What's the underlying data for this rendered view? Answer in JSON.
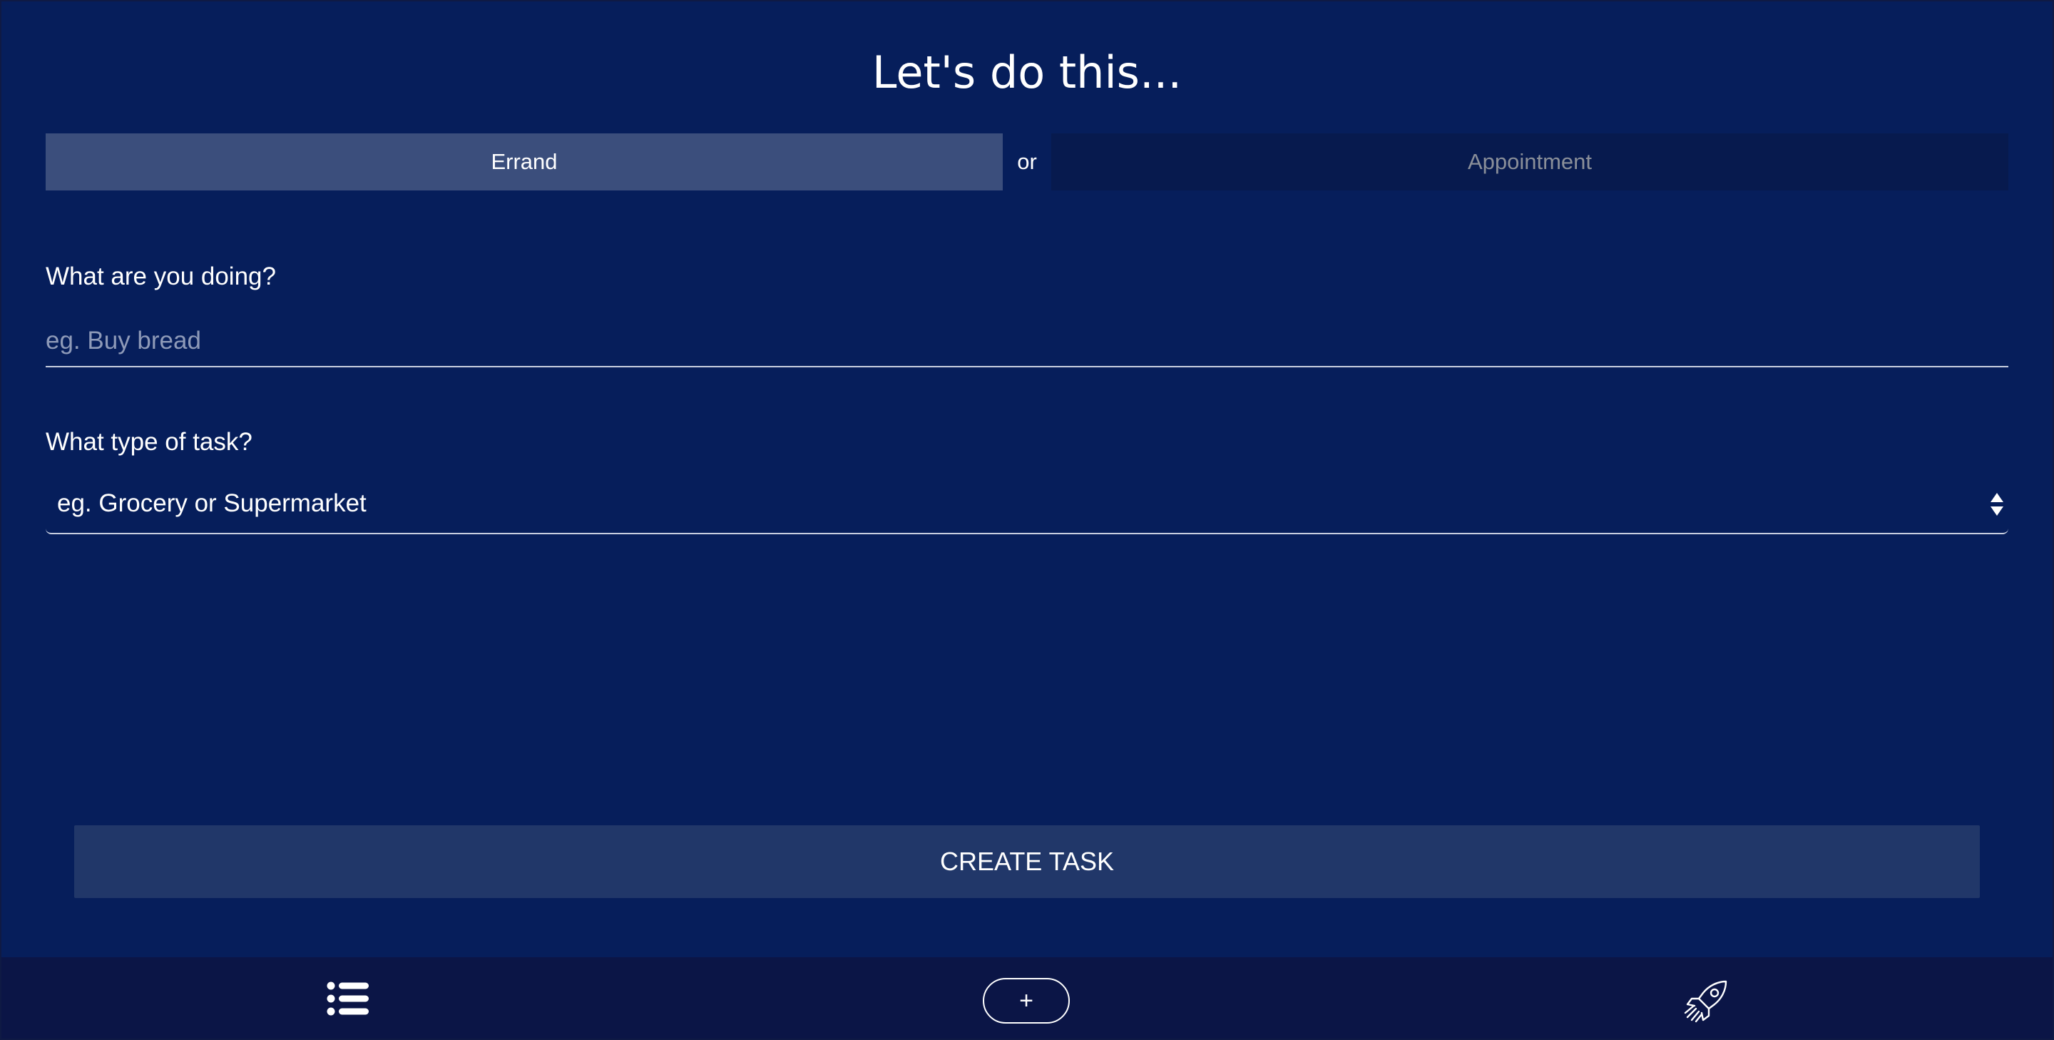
{
  "header": {
    "title": "Let's do this..."
  },
  "task_kind": {
    "options": [
      "Errand",
      "Appointment"
    ],
    "separator": "or",
    "selected": "Errand"
  },
  "form": {
    "doing": {
      "label": "What are you doing?",
      "value": "",
      "placeholder": "eg. Buy bread"
    },
    "type": {
      "label": "What type of task?",
      "selected_value": "eg. Grocery or Supermarket"
    }
  },
  "actions": {
    "create_label": "CREATE TASK"
  },
  "nav": {
    "list_icon": "list-icon",
    "add_label": "+",
    "rocket_icon": "rocket-icon"
  },
  "colors": {
    "background": "#061e5b",
    "toggle_active": "#3b4e7c",
    "toggle_inactive": "#071a4e",
    "button": "#213769",
    "nav_bar": "#0b1546"
  }
}
